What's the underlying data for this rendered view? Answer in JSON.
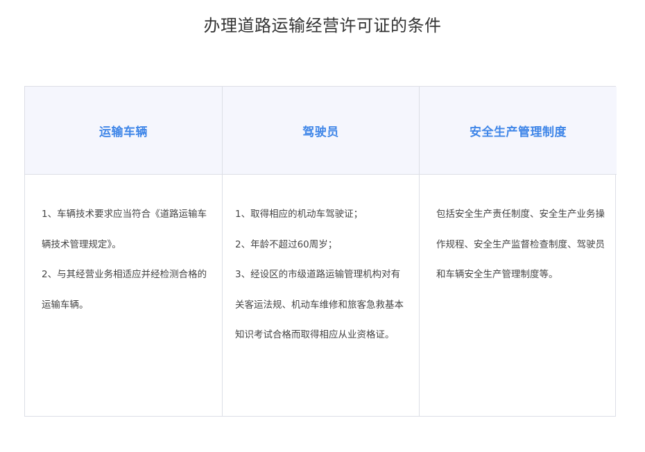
{
  "title": "办理道路运输经营许可证的条件",
  "columns": [
    {
      "header": "运输车辆",
      "paragraphs": [
        "1、车辆技术要求应当符合《道路运输车辆技术管理规定》。",
        "2、与其经营业务相适应并经检测合格的运输车辆。"
      ]
    },
    {
      "header": "驾驶员",
      "paragraphs": [
        "1、取得相应的机动车驾驶证；",
        "2、年龄不超过60周岁；",
        "3、经设区的市级道路运输管理机构对有关客运法规、机动车维修和旅客急救基本知识考试合格而取得相应从业资格证。"
      ]
    },
    {
      "header": "安全生产管理制度",
      "paragraphs": [
        "包括安全生产责任制度、安全生产业务操作规程、安全生产监督检查制度、驾驶员和车辆安全生产管理制度等。"
      ]
    }
  ]
}
